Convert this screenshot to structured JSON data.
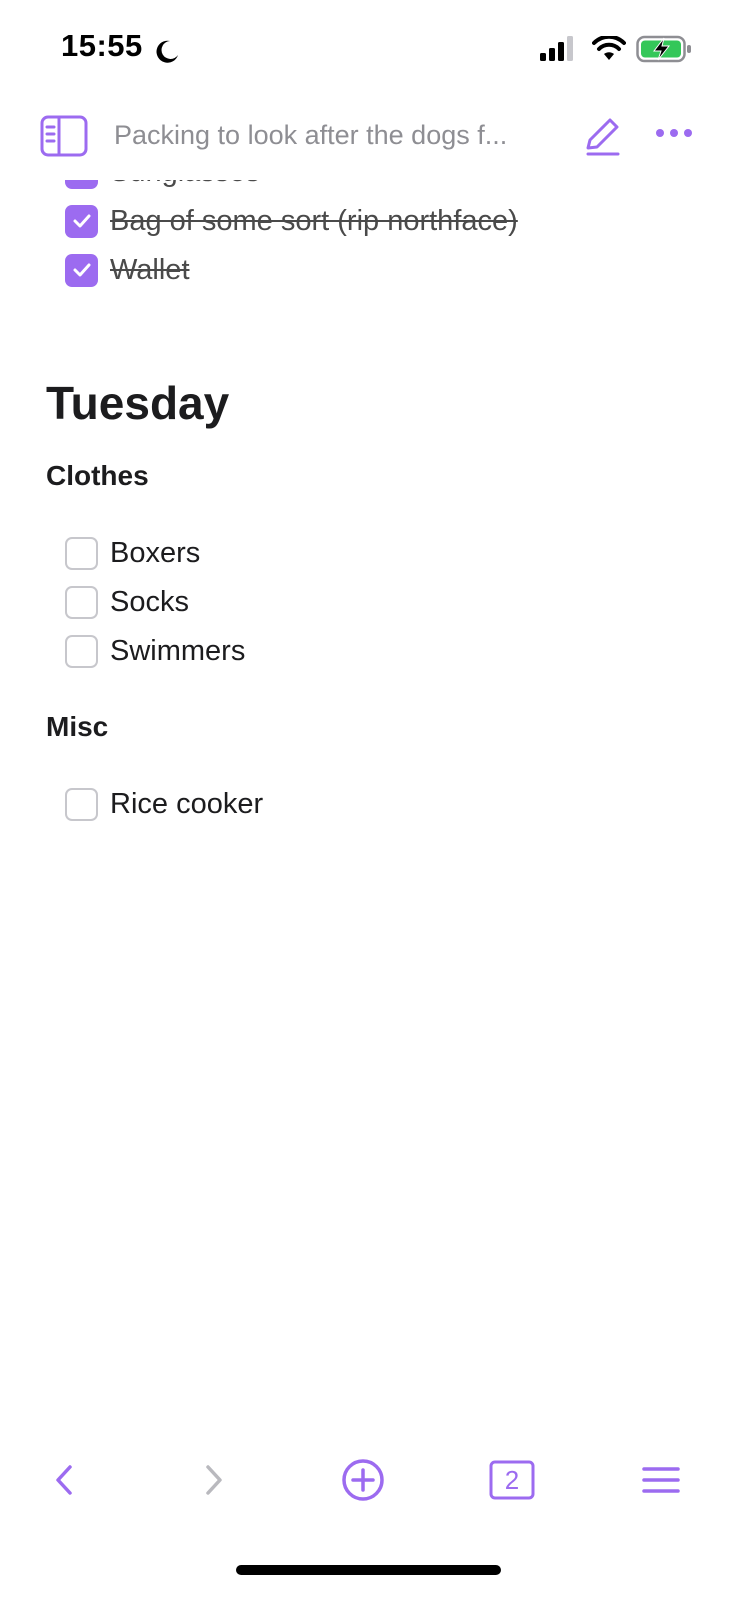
{
  "status_bar": {
    "time": "15:55",
    "icons": [
      "moon-icon",
      "signal-icon",
      "wifi-icon",
      "battery-charging-icon"
    ]
  },
  "toolbar": {
    "title": "Packing to look after the dogs f...",
    "icons": [
      "sidebar-toggle-icon",
      "pencil-icon",
      "more-icon"
    ]
  },
  "checklist_top": [
    {
      "label": "Sunglasses",
      "checked": true
    },
    {
      "label": "Bag of some sort (rip northface)",
      "checked": true
    },
    {
      "label": "Wallet",
      "checked": true
    }
  ],
  "tuesday": {
    "heading": "Tuesday",
    "clothes": {
      "heading": "Clothes",
      "items": [
        {
          "label": "Boxers",
          "checked": false
        },
        {
          "label": "Socks",
          "checked": false
        },
        {
          "label": "Swimmers",
          "checked": false
        }
      ]
    },
    "misc": {
      "heading": "Misc",
      "items": [
        {
          "label": "Rice cooker",
          "checked": false
        }
      ]
    }
  },
  "bottom_bar": {
    "tabs_count": "2",
    "icons": [
      "back-icon",
      "forward-icon",
      "new-note-icon",
      "tabs-icon",
      "menu-icon"
    ]
  },
  "colors": {
    "accent": "#9c6bf0",
    "text": "#1c1c1e",
    "muted": "#8e8e93",
    "checkbox_border": "#c7c7cc"
  }
}
